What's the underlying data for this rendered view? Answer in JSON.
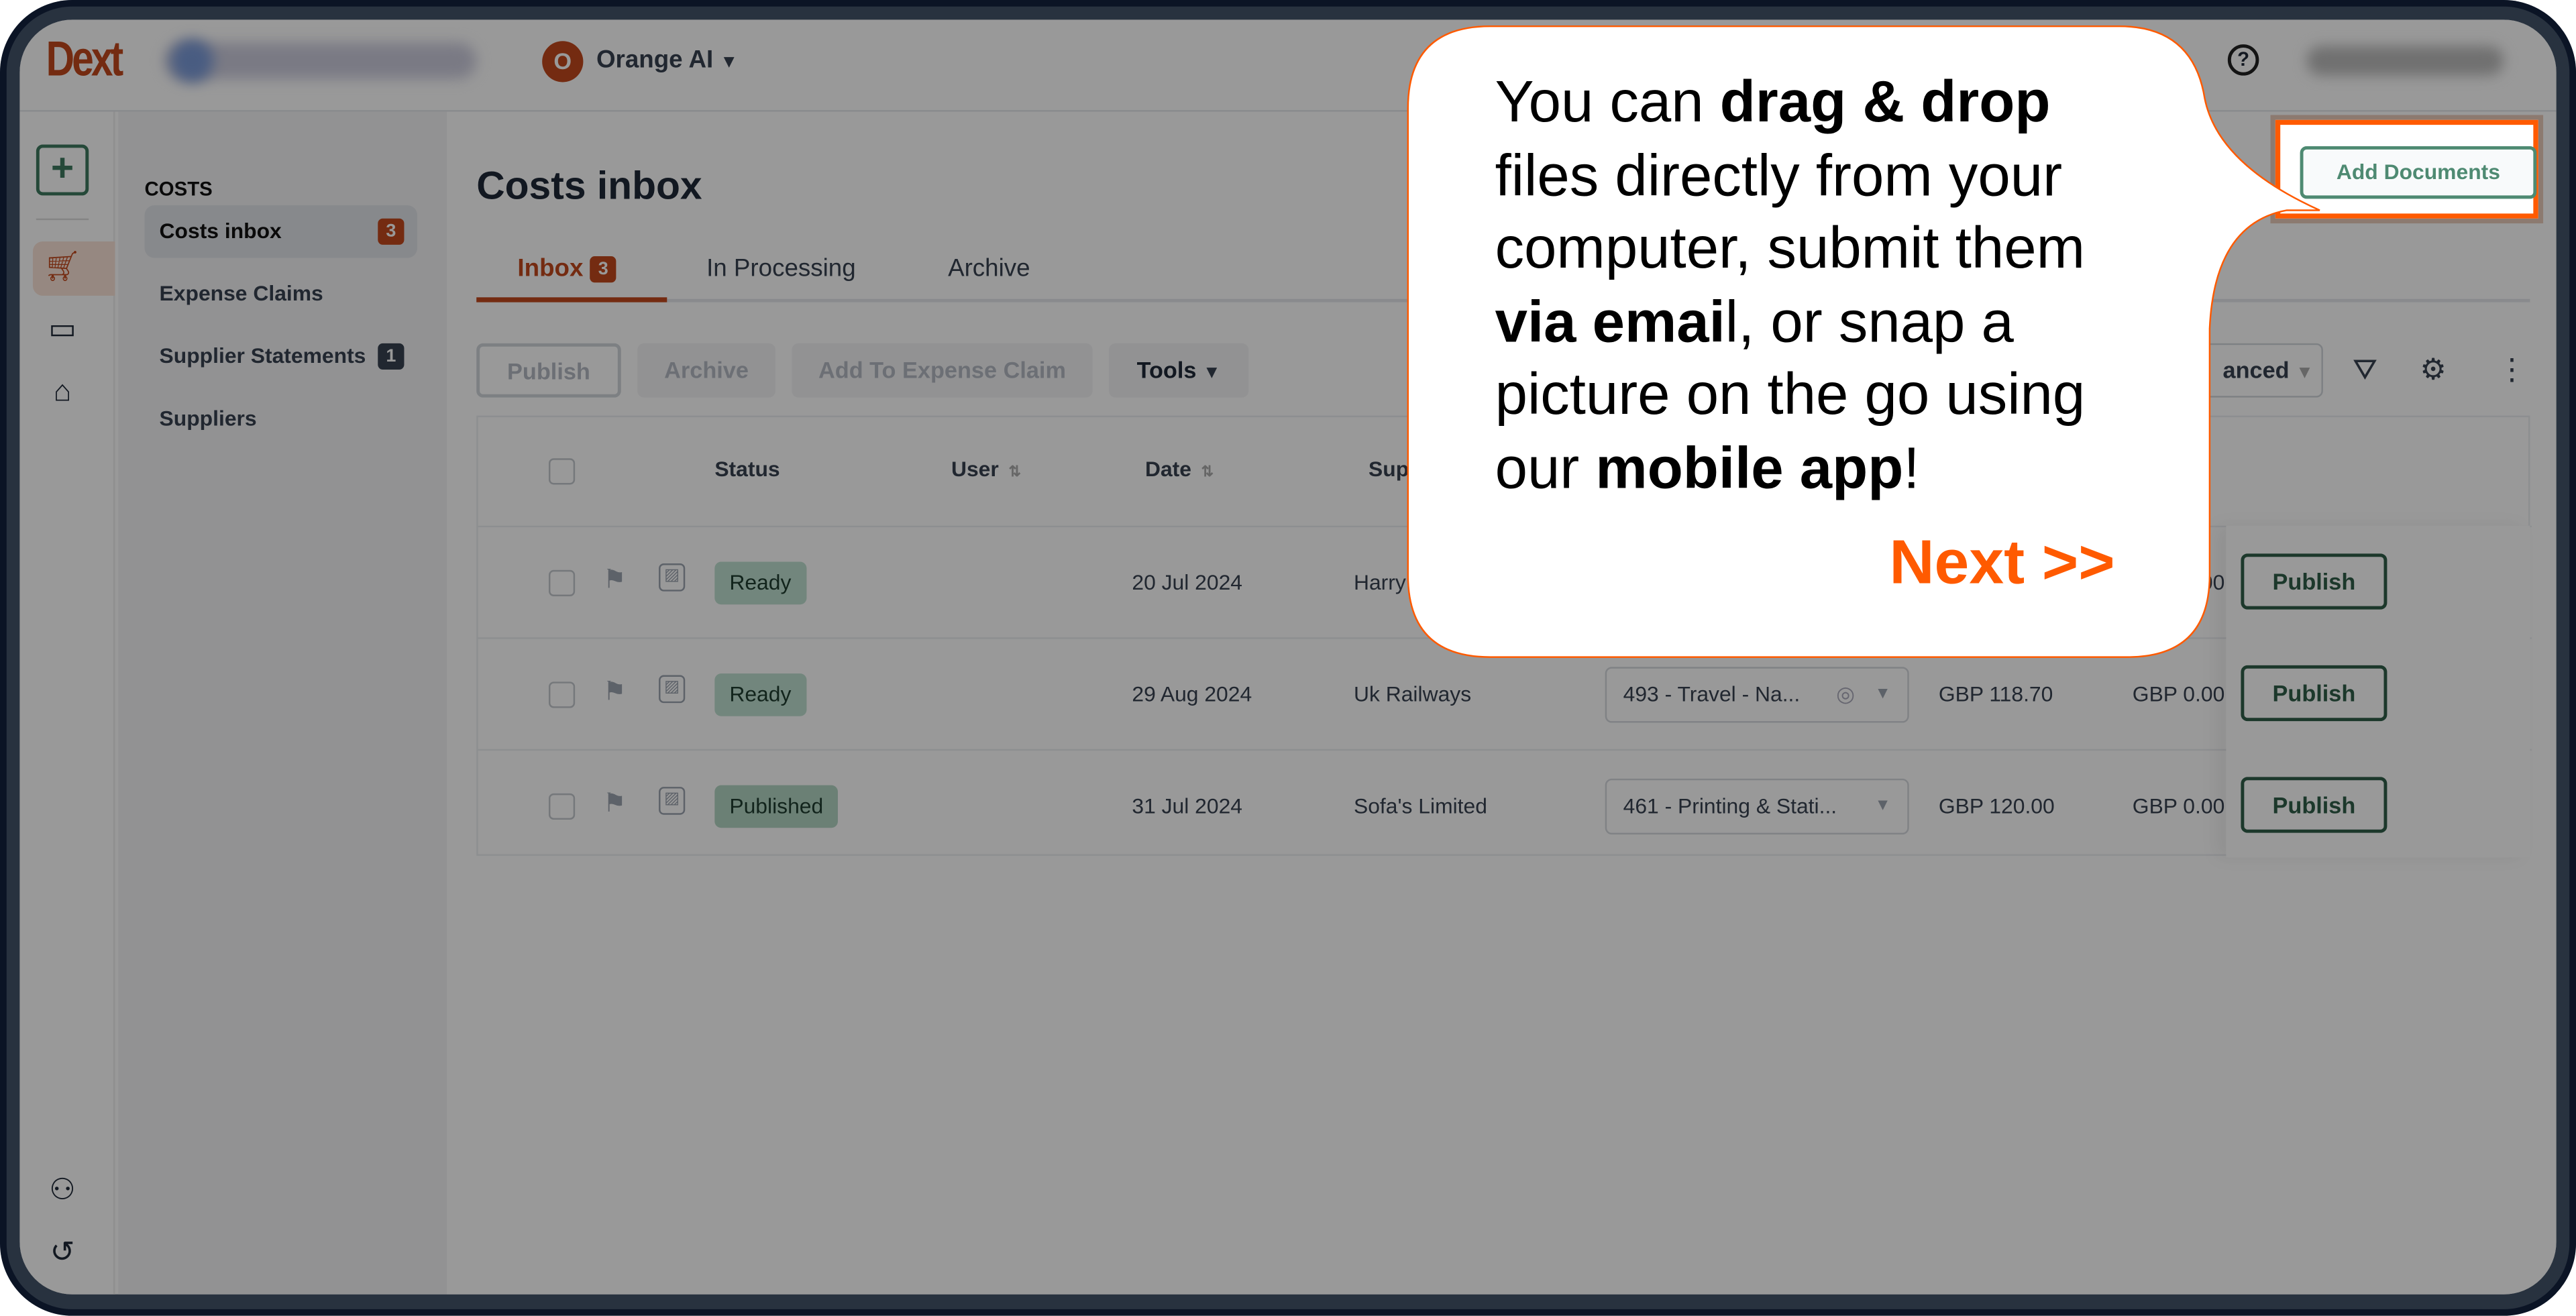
{
  "colors": {
    "brand": "#c2491d",
    "accent_green": "#2f5e49",
    "highlight": "#ff5a00",
    "frame": "#13223f"
  },
  "topbar": {
    "logo": "Dext",
    "org_avatar": "O",
    "org_name": "Orange AI",
    "help_icon": "question-circle-icon"
  },
  "rail": {
    "icons": [
      "plus-icon",
      "cart-icon",
      "wallet-icon",
      "bank-icon",
      "users-icon",
      "history-icon"
    ]
  },
  "sidebar": {
    "heading": "COSTS",
    "items": [
      {
        "label": "Costs inbox",
        "badge": "3"
      },
      {
        "label": "Expense Claims"
      },
      {
        "label": "Supplier Statements",
        "badge": "1"
      },
      {
        "label": "Suppliers"
      }
    ]
  },
  "main": {
    "title": "Costs inbox",
    "tabs": [
      {
        "label": "Inbox",
        "badge": "3"
      },
      {
        "label": "In Processing"
      },
      {
        "label": "Archive"
      }
    ],
    "toolbar": {
      "publish": "Publish",
      "archive": "Archive",
      "add_to_claim": "Add To Expense Claim",
      "tools": "Tools",
      "view": "anced"
    },
    "add_documents": "Add Documents",
    "table": {
      "headers": {
        "status": "Status",
        "user": "User",
        "date": "Date",
        "supplier": "Sup"
      },
      "rows": [
        {
          "status": "Ready",
          "date": "20 Jul 2024",
          "supplier": "Harry",
          "category": "",
          "amount": "",
          "tax": "GBP 0.00",
          "action": "Publish"
        },
        {
          "status": "Ready",
          "date": "29 Aug 2024",
          "supplier": "Uk Railways",
          "category": "493 - Travel - Na...",
          "amount": "GBP 118.70",
          "tax": "GBP 0.00",
          "action": "Publish"
        },
        {
          "status": "Published",
          "date": "31 Jul 2024",
          "supplier": "Sofa's Limited",
          "category": "461 - Printing & Stati...",
          "amount": "GBP 120.00",
          "tax": "GBP 0.00",
          "action": "Publish"
        }
      ]
    }
  },
  "tour": {
    "lines": [
      [
        {
          "t": "You can "
        },
        {
          "t": "drag & drop",
          "b": true
        }
      ],
      [
        {
          "t": "files directly from your"
        }
      ],
      [
        {
          "t": "computer, submit them"
        }
      ],
      [
        {
          "t": "via emai",
          "b": true
        },
        {
          "t": "l, or snap a"
        }
      ],
      [
        {
          "t": "picture on the go using"
        }
      ],
      [
        {
          "t": "our "
        },
        {
          "t": "mobile app",
          "b": true
        },
        {
          "t": "!"
        }
      ]
    ],
    "next": "Next >>"
  }
}
